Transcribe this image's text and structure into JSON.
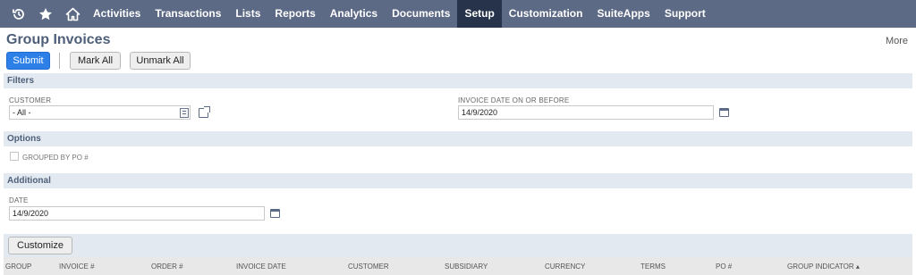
{
  "nav": {
    "icons": [
      "recent-icon",
      "star-icon",
      "home-icon"
    ],
    "items": [
      {
        "label": "Activities",
        "active": false
      },
      {
        "label": "Transactions",
        "active": false
      },
      {
        "label": "Lists",
        "active": false
      },
      {
        "label": "Reports",
        "active": false
      },
      {
        "label": "Analytics",
        "active": false
      },
      {
        "label": "Documents",
        "active": false
      },
      {
        "label": "Setup",
        "active": true
      },
      {
        "label": "Customization",
        "active": false
      },
      {
        "label": "SuiteApps",
        "active": false
      },
      {
        "label": "Support",
        "active": false
      }
    ]
  },
  "page": {
    "title": "Group Invoices",
    "more": "More"
  },
  "toolbar": {
    "submit": "Submit",
    "mark_all": "Mark All",
    "unmark_all": "Unmark All"
  },
  "filters": {
    "section": "Filters",
    "customer_label": "CUSTOMER",
    "customer_value": "- All -",
    "invoice_date_label": "INVOICE DATE ON OR BEFORE",
    "invoice_date_value": "14/9/2020"
  },
  "options": {
    "section": "Options",
    "grouped_by_po_label": "GROUPED BY PO #",
    "grouped_by_po_checked": false
  },
  "additional": {
    "section": "Additional",
    "date_label": "DATE",
    "date_value": "14/9/2020"
  },
  "list": {
    "customize": "Customize",
    "columns": [
      "GROUP",
      "INVOICE #",
      "ORDER #",
      "INVOICE DATE",
      "CUSTOMER",
      "SUBSIDIARY",
      "CURRENCY",
      "TERMS",
      "PO #",
      "GROUP INDICATOR ▴"
    ]
  },
  "colors": {
    "nav_bg": "#5c6a86",
    "nav_active": "#27334a",
    "primary_button": "#2d80e8",
    "section_bg": "#e3e9f1",
    "title_color": "#4d5f79"
  }
}
